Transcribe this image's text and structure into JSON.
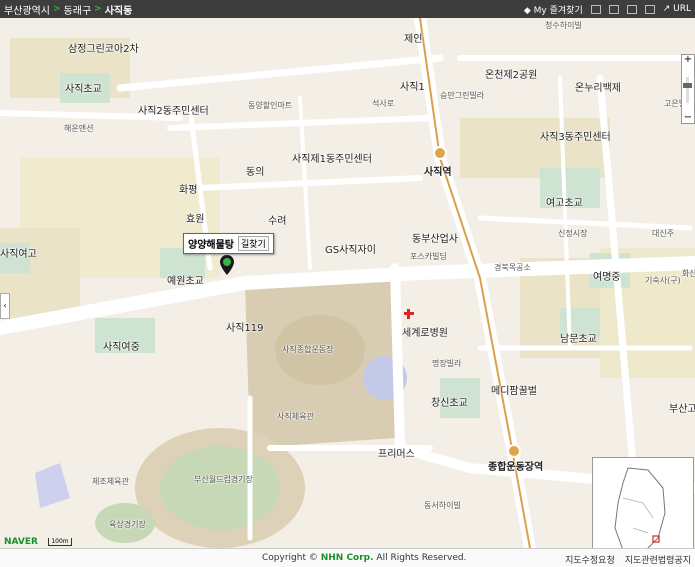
{
  "breadcrumb": {
    "city": "부산광역시",
    "district": "동래구",
    "neighborhood": "사직동"
  },
  "tools": {
    "favorites": "My 즐겨찾기",
    "url": "URL"
  },
  "labels": {
    "samjeong": "삼정그린코아2차",
    "sajik_elem": "사직초교",
    "sajik2": "사직2동주민센터",
    "haeun": "해운맨션",
    "dongyang": "동양할인마트",
    "jein": "제인",
    "sajik1": "사직1",
    "seoksa": "석사로",
    "seungmin": "승만그린빌라",
    "oncheon2": "온천제2공원",
    "onnuri": "온누리백제",
    "sajik3": "사직3동주민센터",
    "sajikje1": "사직제1동주민센터",
    "dongui": "동의",
    "hwapyeong": "화평",
    "hyowon": "효원",
    "sura": "수려",
    "sajik_station": "사직역",
    "yeogo": "여고초교",
    "sinjeong": "신정시장",
    "daeshin": "대신주",
    "gs": "GS사직자이",
    "dongbusan": "동부산업사",
    "poscar": "포스카빌딩",
    "gyeongbuk": "경북목공소",
    "yeomyeong": "여명중",
    "gisu": "기숙사(구)",
    "sajikyeogo": "사직여고",
    "yewon": "예원초교",
    "sajik119": "사직119",
    "sajik_stadium": "사직종합운동장",
    "segyero": "세계로병원",
    "namsan": "남문초교",
    "sajik_mid": "사직여중",
    "myeongjang": "명장빌라",
    "medipam": "메디팜꿀벌",
    "changsin": "창신초교",
    "sajik_gym": "사직체육관",
    "freemers": "프리머스",
    "busan_right": "부산고",
    "sports_complex": "종합운동장역",
    "cheongsu": "청수하이빌",
    "chejo": "체조체육관",
    "worldcup": "부산월드컵경기장",
    "athletics": "육상경기장",
    "dongseo": "동서하이빌",
    "goeun": "고은빌",
    "hwasan": "화산"
  },
  "popup": {
    "name": "양양해물탕",
    "directions": "길찾기"
  },
  "scale_text": "100m",
  "brand": "NAVER",
  "footer": {
    "copyright_pre": "Copyright ©",
    "company": "NHN Corp.",
    "rights": "All Rights Reserved.",
    "edit": "지도수정요청",
    "terms": "지도관련법령공지"
  }
}
